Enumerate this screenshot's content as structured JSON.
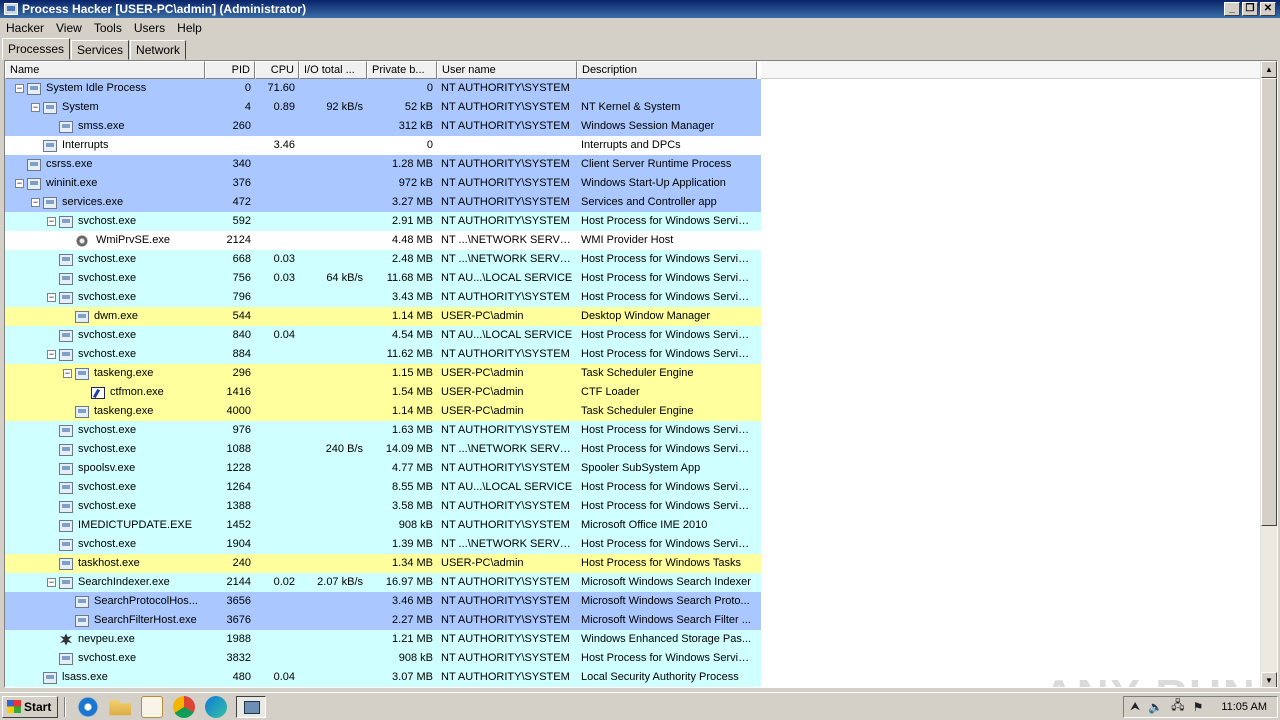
{
  "window": {
    "title": "Process Hacker [USER-PC\\admin] (Administrator)",
    "minimize": "_",
    "restore": "❐",
    "close": "✕"
  },
  "menu": [
    "Hacker",
    "View",
    "Tools",
    "Users",
    "Help"
  ],
  "tabs": [
    "Processes",
    "Services",
    "Network"
  ],
  "columns": [
    "Name",
    "PID",
    "CPU",
    "I/O total ...",
    "Private b...",
    "User name",
    "Description"
  ],
  "processes": [
    {
      "name": "System Idle Process",
      "pid": "0",
      "cpu": "71.60",
      "io": "",
      "priv": "0",
      "user": "NT AUTHORITY\\SYSTEM",
      "desc": "",
      "level": 0,
      "toggle": "⊟",
      "bg": "system",
      "icon": "window"
    },
    {
      "name": "System",
      "pid": "4",
      "cpu": "0.89",
      "io": "92 kB/s",
      "priv": "52 kB",
      "user": "NT AUTHORITY\\SYSTEM",
      "desc": "NT Kernel & System",
      "level": 1,
      "toggle": "⊟",
      "bg": "system",
      "icon": "window"
    },
    {
      "name": "smss.exe",
      "pid": "260",
      "cpu": "",
      "io": "",
      "priv": "312 kB",
      "user": "NT AUTHORITY\\SYSTEM",
      "desc": "Windows Session Manager",
      "level": 2,
      "toggle": "",
      "bg": "system",
      "icon": "window"
    },
    {
      "name": "Interrupts",
      "pid": "",
      "cpu": "3.46",
      "io": "",
      "priv": "0",
      "user": "",
      "desc": "Interrupts and DPCs",
      "level": 1,
      "toggle": "",
      "bg": "none",
      "icon": "window"
    },
    {
      "name": "csrss.exe",
      "pid": "340",
      "cpu": "",
      "io": "",
      "priv": "1.28 MB",
      "user": "NT AUTHORITY\\SYSTEM",
      "desc": "Client Server Runtime Process",
      "level": 0,
      "toggle": "",
      "bg": "system",
      "icon": "window"
    },
    {
      "name": "wininit.exe",
      "pid": "376",
      "cpu": "",
      "io": "",
      "priv": "972 kB",
      "user": "NT AUTHORITY\\SYSTEM",
      "desc": "Windows Start-Up Application",
      "level": 0,
      "toggle": "⊟",
      "bg": "system",
      "icon": "window"
    },
    {
      "name": "services.exe",
      "pid": "472",
      "cpu": "",
      "io": "",
      "priv": "3.27 MB",
      "user": "NT AUTHORITY\\SYSTEM",
      "desc": "Services and Controller app",
      "level": 1,
      "toggle": "⊟",
      "bg": "system",
      "icon": "window"
    },
    {
      "name": "svchost.exe",
      "pid": "592",
      "cpu": "",
      "io": "",
      "priv": "2.91 MB",
      "user": "NT AUTHORITY\\SYSTEM",
      "desc": "Host Process for Windows Services",
      "level": 2,
      "toggle": "⊟",
      "bg": "service",
      "icon": "window"
    },
    {
      "name": "WmiPrvSE.exe",
      "pid": "2124",
      "cpu": "",
      "io": "",
      "priv": "4.48 MB",
      "user": "NT ...\\NETWORK SERVICE",
      "desc": "WMI Provider Host",
      "level": 3,
      "toggle": "",
      "bg": "none",
      "icon": "gear"
    },
    {
      "name": "svchost.exe",
      "pid": "668",
      "cpu": "0.03",
      "io": "",
      "priv": "2.48 MB",
      "user": "NT ...\\NETWORK SERVICE",
      "desc": "Host Process for Windows Services",
      "level": 2,
      "toggle": "",
      "bg": "service",
      "icon": "window"
    },
    {
      "name": "svchost.exe",
      "pid": "756",
      "cpu": "0.03",
      "io": "64 kB/s",
      "priv": "11.68 MB",
      "user": "NT AU...\\LOCAL SERVICE",
      "desc": "Host Process for Windows Services",
      "level": 2,
      "toggle": "",
      "bg": "service",
      "icon": "window"
    },
    {
      "name": "svchost.exe",
      "pid": "796",
      "cpu": "",
      "io": "",
      "priv": "3.43 MB",
      "user": "NT AUTHORITY\\SYSTEM",
      "desc": "Host Process for Windows Services",
      "level": 2,
      "toggle": "⊟",
      "bg": "service",
      "icon": "window"
    },
    {
      "name": "dwm.exe",
      "pid": "544",
      "cpu": "",
      "io": "",
      "priv": "1.14 MB",
      "user": "USER-PC\\admin",
      "desc": "Desktop Window Manager",
      "level": 3,
      "toggle": "",
      "bg": "user",
      "icon": "window"
    },
    {
      "name": "svchost.exe",
      "pid": "840",
      "cpu": "0.04",
      "io": "",
      "priv": "4.54 MB",
      "user": "NT AU...\\LOCAL SERVICE",
      "desc": "Host Process for Windows Services",
      "level": 2,
      "toggle": "",
      "bg": "service",
      "icon": "window"
    },
    {
      "name": "svchost.exe",
      "pid": "884",
      "cpu": "",
      "io": "",
      "priv": "11.62 MB",
      "user": "NT AUTHORITY\\SYSTEM",
      "desc": "Host Process for Windows Services",
      "level": 2,
      "toggle": "⊟",
      "bg": "service",
      "icon": "window"
    },
    {
      "name": "taskeng.exe",
      "pid": "296",
      "cpu": "",
      "io": "",
      "priv": "1.15 MB",
      "user": "USER-PC\\admin",
      "desc": "Task Scheduler Engine",
      "level": 3,
      "toggle": "⊟",
      "bg": "user",
      "icon": "window"
    },
    {
      "name": "ctfmon.exe",
      "pid": "1416",
      "cpu": "",
      "io": "",
      "priv": "1.54 MB",
      "user": "USER-PC\\admin",
      "desc": "CTF Loader",
      "level": 4,
      "toggle": "",
      "bg": "user",
      "icon": "note"
    },
    {
      "name": "taskeng.exe",
      "pid": "4000",
      "cpu": "",
      "io": "",
      "priv": "1.14 MB",
      "user": "USER-PC\\admin",
      "desc": "Task Scheduler Engine",
      "level": 3,
      "toggle": "",
      "bg": "user",
      "icon": "window"
    },
    {
      "name": "svchost.exe",
      "pid": "976",
      "cpu": "",
      "io": "",
      "priv": "1.63 MB",
      "user": "NT AUTHORITY\\SYSTEM",
      "desc": "Host Process for Windows Services",
      "level": 2,
      "toggle": "",
      "bg": "service",
      "icon": "window"
    },
    {
      "name": "svchost.exe",
      "pid": "1088",
      "cpu": "",
      "io": "240 B/s",
      "priv": "14.09 MB",
      "user": "NT ...\\NETWORK SERVICE",
      "desc": "Host Process for Windows Services",
      "level": 2,
      "toggle": "",
      "bg": "service",
      "icon": "window"
    },
    {
      "name": "spoolsv.exe",
      "pid": "1228",
      "cpu": "",
      "io": "",
      "priv": "4.77 MB",
      "user": "NT AUTHORITY\\SYSTEM",
      "desc": "Spooler SubSystem App",
      "level": 2,
      "toggle": "",
      "bg": "service",
      "icon": "window"
    },
    {
      "name": "svchost.exe",
      "pid": "1264",
      "cpu": "",
      "io": "",
      "priv": "8.55 MB",
      "user": "NT AU...\\LOCAL SERVICE",
      "desc": "Host Process for Windows Services",
      "level": 2,
      "toggle": "",
      "bg": "service",
      "icon": "window"
    },
    {
      "name": "svchost.exe",
      "pid": "1388",
      "cpu": "",
      "io": "",
      "priv": "3.58 MB",
      "user": "NT AUTHORITY\\SYSTEM",
      "desc": "Host Process for Windows Services",
      "level": 2,
      "toggle": "",
      "bg": "service",
      "icon": "window"
    },
    {
      "name": "IMEDICTUPDATE.EXE",
      "pid": "1452",
      "cpu": "",
      "io": "",
      "priv": "908 kB",
      "user": "NT AUTHORITY\\SYSTEM",
      "desc": "Microsoft Office IME 2010",
      "level": 2,
      "toggle": "",
      "bg": "service",
      "icon": "window"
    },
    {
      "name": "svchost.exe",
      "pid": "1904",
      "cpu": "",
      "io": "",
      "priv": "1.39 MB",
      "user": "NT ...\\NETWORK SERVICE",
      "desc": "Host Process for Windows Services",
      "level": 2,
      "toggle": "",
      "bg": "service",
      "icon": "window"
    },
    {
      "name": "taskhost.exe",
      "pid": "240",
      "cpu": "",
      "io": "",
      "priv": "1.34 MB",
      "user": "USER-PC\\admin",
      "desc": "Host Process for Windows Tasks",
      "level": 2,
      "toggle": "",
      "bg": "user",
      "icon": "window"
    },
    {
      "name": "SearchIndexer.exe",
      "pid": "2144",
      "cpu": "0.02",
      "io": "2.07 kB/s",
      "priv": "16.97 MB",
      "user": "NT AUTHORITY\\SYSTEM",
      "desc": "Microsoft Windows Search Indexer",
      "level": 2,
      "toggle": "⊟",
      "bg": "service",
      "icon": "window"
    },
    {
      "name": "SearchProtocolHos...",
      "pid": "3656",
      "cpu": "",
      "io": "",
      "priv": "3.46 MB",
      "user": "NT AUTHORITY\\SYSTEM",
      "desc": "Microsoft Windows Search Proto...",
      "level": 3,
      "toggle": "",
      "bg": "system",
      "icon": "window"
    },
    {
      "name": "SearchFilterHost.exe",
      "pid": "3676",
      "cpu": "",
      "io": "",
      "priv": "2.27 MB",
      "user": "NT AUTHORITY\\SYSTEM",
      "desc": "Microsoft Windows Search Filter ...",
      "level": 3,
      "toggle": "",
      "bg": "system",
      "icon": "window"
    },
    {
      "name": "nevpeu.exe",
      "pid": "1988",
      "cpu": "",
      "io": "",
      "priv": "1.21 MB",
      "user": "NT AUTHORITY\\SYSTEM",
      "desc": "Windows Enhanced Storage Pas...",
      "level": 2,
      "toggle": "",
      "bg": "service",
      "icon": "bug"
    },
    {
      "name": "svchost.exe",
      "pid": "3832",
      "cpu": "",
      "io": "",
      "priv": "908 kB",
      "user": "NT AUTHORITY\\SYSTEM",
      "desc": "Host Process for Windows Services",
      "level": 2,
      "toggle": "",
      "bg": "service",
      "icon": "window"
    },
    {
      "name": "lsass.exe",
      "pid": "480",
      "cpu": "0.04",
      "io": "",
      "priv": "3.07 MB",
      "user": "NT AUTHORITY\\SYSTEM",
      "desc": "Local Security Authority Process",
      "level": 1,
      "toggle": "",
      "bg": "service",
      "icon": "window"
    }
  ],
  "watermark": "ANY RUN",
  "taskbar": {
    "start_label": "Start",
    "clock": "11:05 AM"
  }
}
